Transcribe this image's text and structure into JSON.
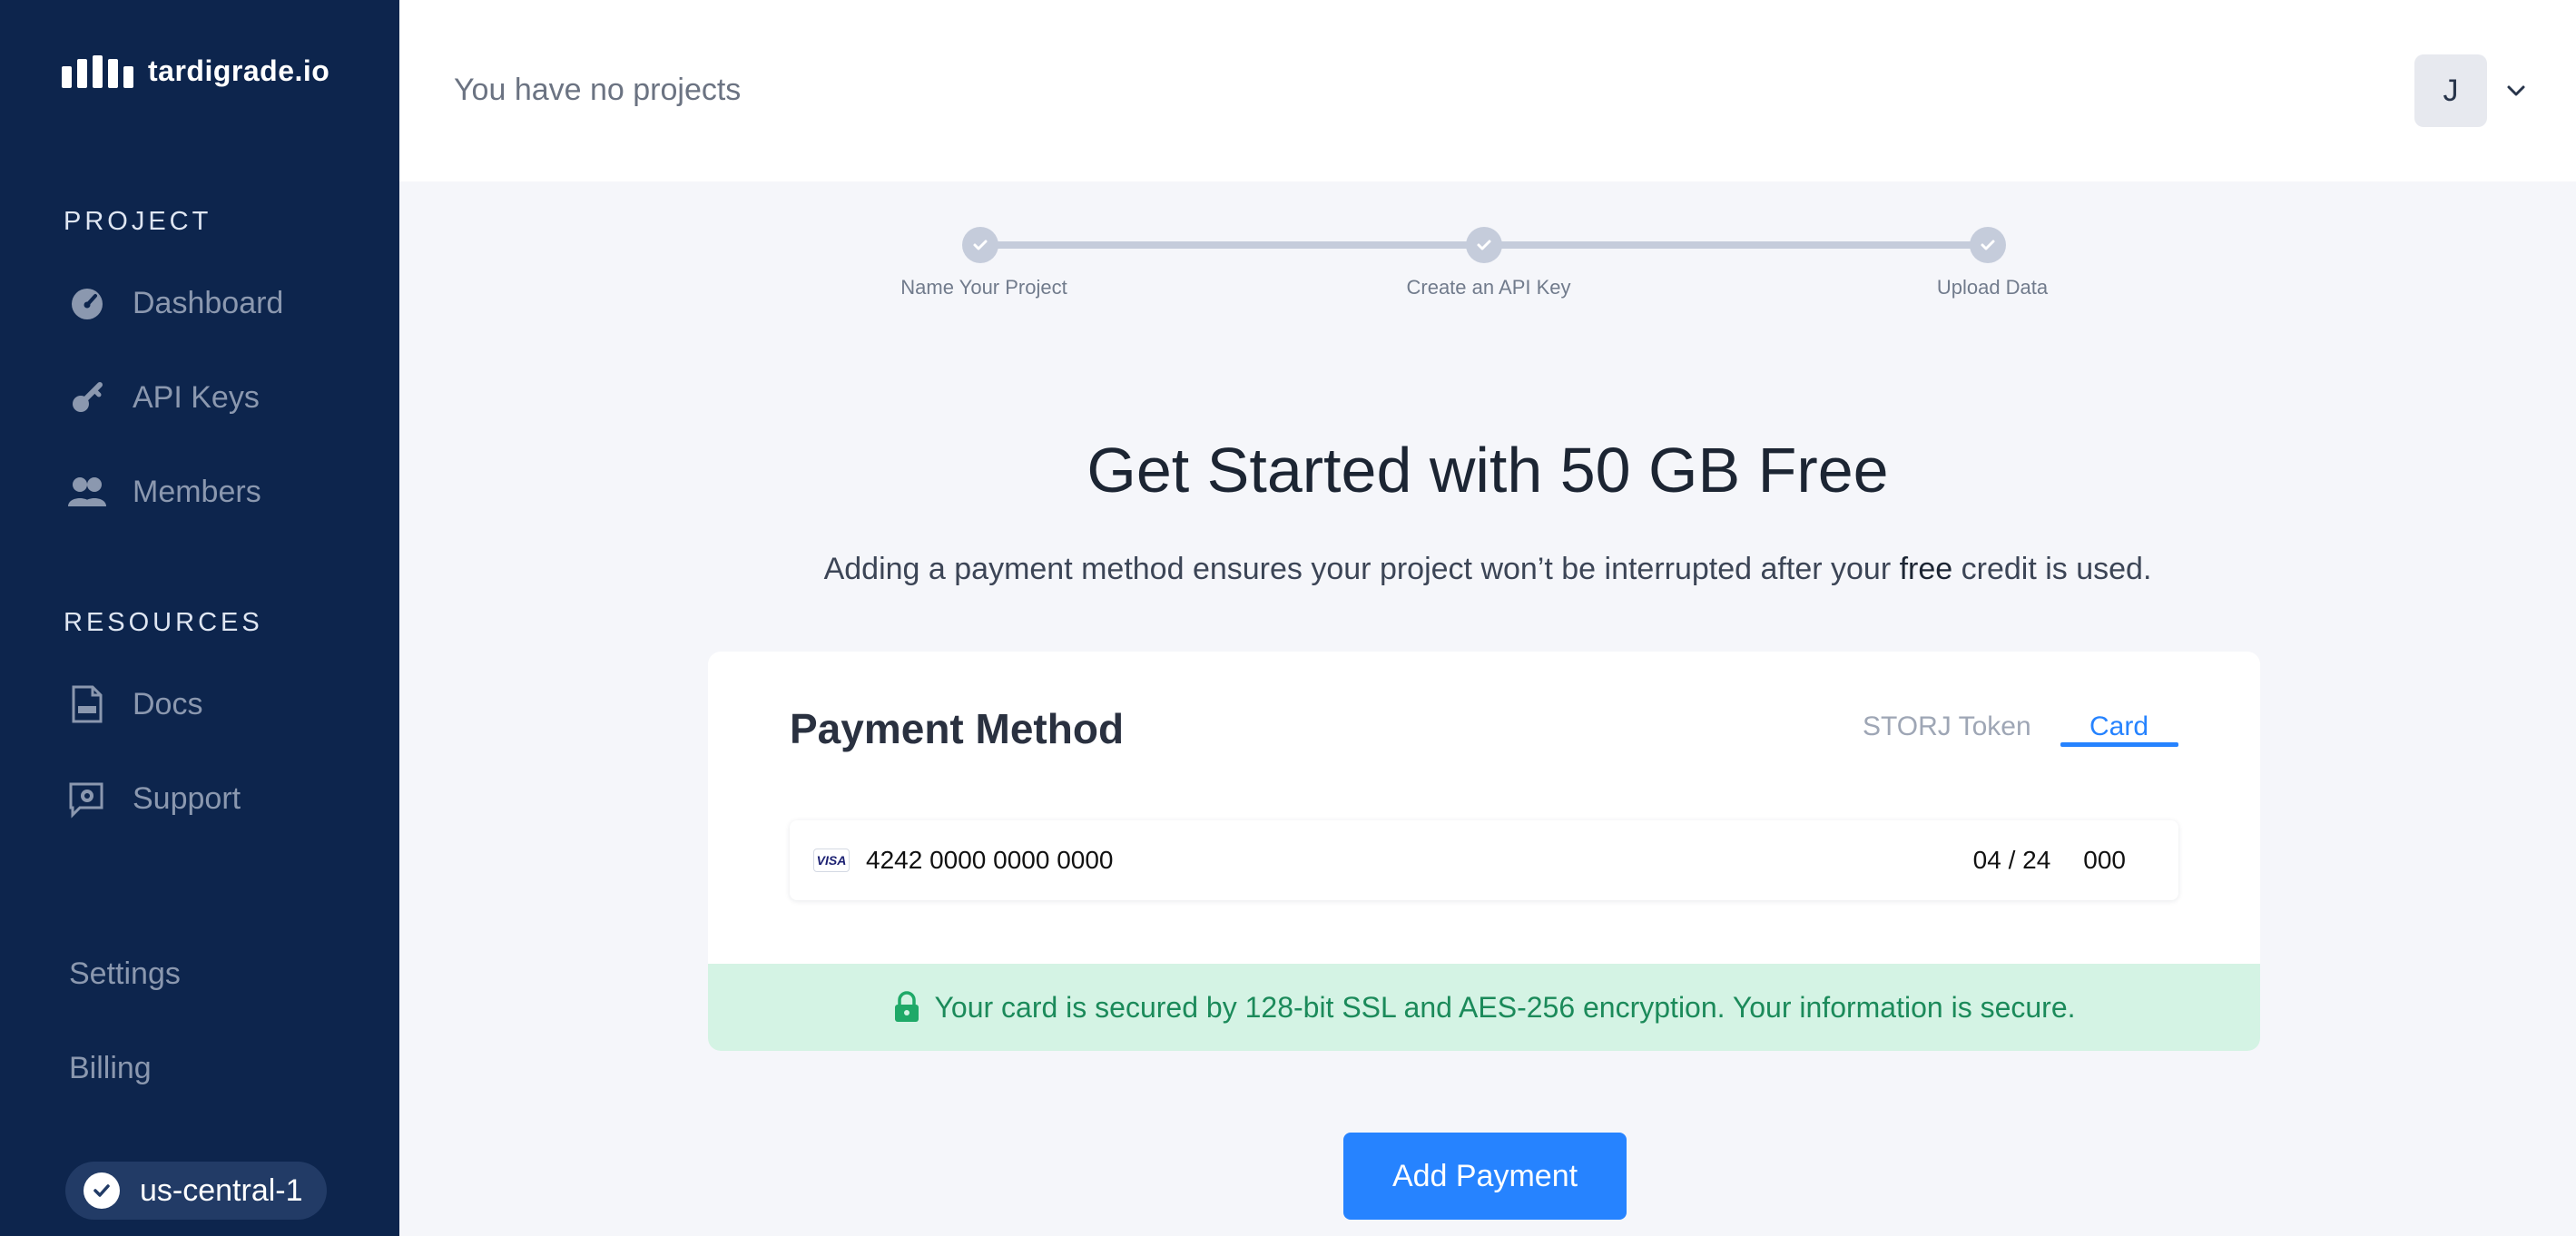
{
  "brand": {
    "name": "tardigrade.io"
  },
  "sidebar": {
    "project_section": "PROJECT",
    "project_items": [
      {
        "label": "Dashboard",
        "icon": "dashboard-icon"
      },
      {
        "label": "API Keys",
        "icon": "key-icon"
      },
      {
        "label": "Members",
        "icon": "members-icon"
      }
    ],
    "resources_section": "RESOURCES",
    "resource_items": [
      {
        "label": "Docs",
        "icon": "docs-icon"
      },
      {
        "label": "Support",
        "icon": "support-icon"
      }
    ],
    "settings_label": "Settings",
    "billing_label": "Billing",
    "region": {
      "label": "us-central-1",
      "icon": "check-circle-icon"
    }
  },
  "header": {
    "title": "You have no projects",
    "avatar_initial": "J"
  },
  "steps": [
    {
      "label": "Name Your Project",
      "done": true
    },
    {
      "label": "Create an API Key",
      "done": true
    },
    {
      "label": "Upload Data",
      "done": true
    }
  ],
  "main": {
    "title": "Get Started with 50 GB Free",
    "subtitle_pre": "Adding a payment method ensures your project won’t be interrupted after your ",
    "subtitle_bold": "free",
    "subtitle_post": " credit is used."
  },
  "payment": {
    "title": "Payment Method",
    "tabs": [
      {
        "label": "STORJ Token",
        "active": false
      },
      {
        "label": "Card",
        "active": true
      }
    ],
    "card_brand": "VISA",
    "card_number": "4242 0000 0000 0000",
    "card_expiry": "04 / 24",
    "card_cvc": "000",
    "secure_message": "Your card is secured by 128-bit SSL and AES-256 encryption. Your information is secure."
  },
  "actions": {
    "add_payment_label": "Add Payment"
  },
  "colors": {
    "sidebar_bg": "#0d254d",
    "accent": "#2683ff",
    "secure_bg": "#d4f3e4",
    "secure_text": "#1b8a5a"
  }
}
